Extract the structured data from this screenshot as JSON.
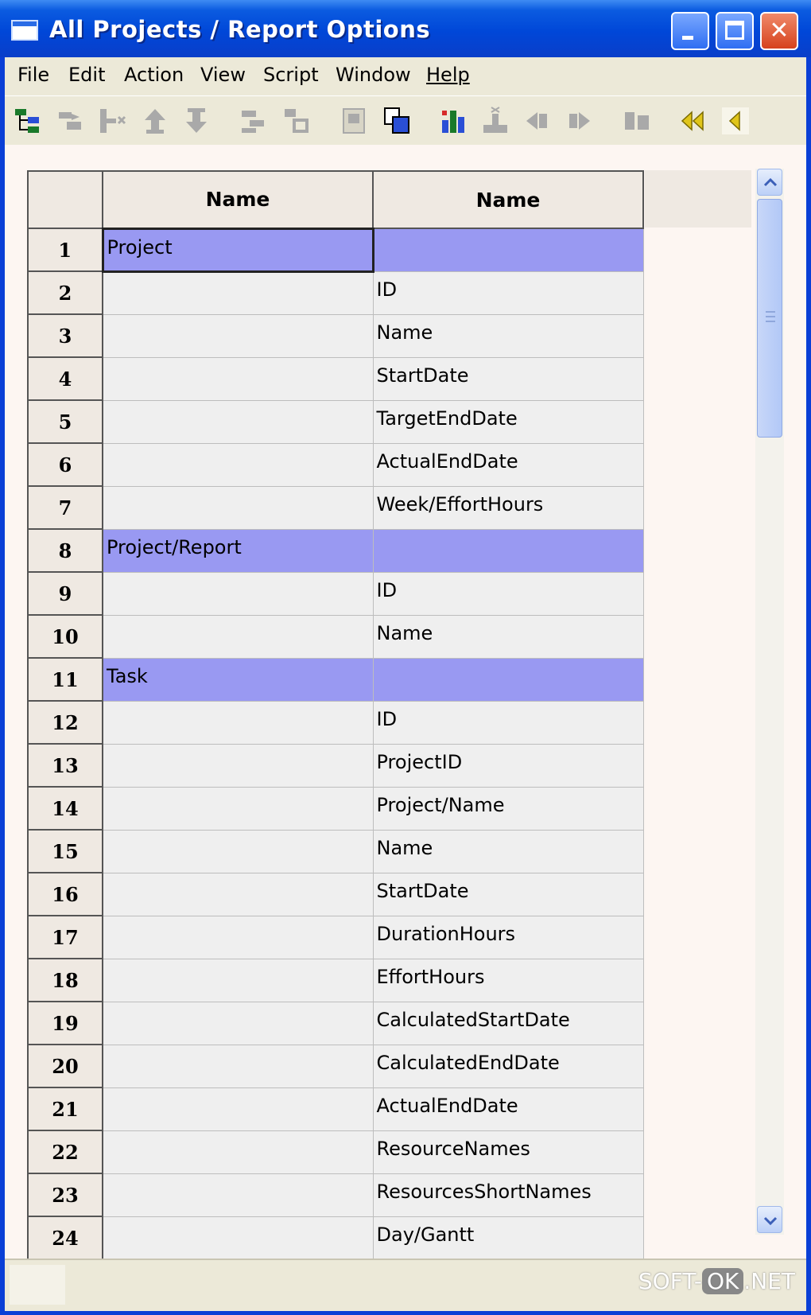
{
  "window": {
    "title": "All Projects / Report Options"
  },
  "menu": [
    "File",
    "Edit",
    "Action",
    "View",
    "Script",
    "Window",
    "Help"
  ],
  "toolbar": {
    "icons": [
      "tree-view-icon",
      "move-right-icon",
      "delete-column-icon",
      "move-up-icon",
      "move-down-icon",
      "indent-icon",
      "outdent-icon",
      "page-icon",
      "copy-icon",
      "chart-icon",
      "insert-icon",
      "prev-icon",
      "next-icon",
      "columns-icon",
      "first-icon",
      "back-icon"
    ]
  },
  "grid": {
    "headers": [
      "Name",
      "Name"
    ],
    "rows": [
      {
        "num": "1",
        "col1": "Project",
        "col2": "",
        "group": true,
        "selected": true
      },
      {
        "num": "2",
        "col1": "",
        "col2": "ID"
      },
      {
        "num": "3",
        "col1": "",
        "col2": "Name"
      },
      {
        "num": "4",
        "col1": "",
        "col2": "StartDate"
      },
      {
        "num": "5",
        "col1": "",
        "col2": "TargetEndDate"
      },
      {
        "num": "6",
        "col1": "",
        "col2": "ActualEndDate"
      },
      {
        "num": "7",
        "col1": "",
        "col2": "Week/EffortHours"
      },
      {
        "num": "8",
        "col1": "Project/Report",
        "col2": "",
        "group": true
      },
      {
        "num": "9",
        "col1": "",
        "col2": "ID"
      },
      {
        "num": "10",
        "col1": "",
        "col2": "Name"
      },
      {
        "num": "11",
        "col1": "Task",
        "col2": "",
        "group": true
      },
      {
        "num": "12",
        "col1": "",
        "col2": "ID"
      },
      {
        "num": "13",
        "col1": "",
        "col2": "ProjectID"
      },
      {
        "num": "14",
        "col1": "",
        "col2": "Project/Name"
      },
      {
        "num": "15",
        "col1": "",
        "col2": "Name"
      },
      {
        "num": "16",
        "col1": "",
        "col2": "StartDate"
      },
      {
        "num": "17",
        "col1": "",
        "col2": "DurationHours"
      },
      {
        "num": "18",
        "col1": "",
        "col2": "EffortHours"
      },
      {
        "num": "19",
        "col1": "",
        "col2": "CalculatedStartDate"
      },
      {
        "num": "20",
        "col1": "",
        "col2": "CalculatedEndDate"
      },
      {
        "num": "21",
        "col1": "",
        "col2": "ActualEndDate"
      },
      {
        "num": "22",
        "col1": "",
        "col2": "ResourceNames"
      },
      {
        "num": "23",
        "col1": "",
        "col2": "ResourcesShortNames"
      },
      {
        "num": "24",
        "col1": "",
        "col2": "Day/Gantt"
      }
    ]
  },
  "watermark": {
    "left": "SOFT-",
    "ok": "OK",
    "right": ".NET"
  },
  "colors": {
    "group_row": "#9999f2",
    "titlebar": "#0047d8",
    "cell": "#efefef"
  }
}
